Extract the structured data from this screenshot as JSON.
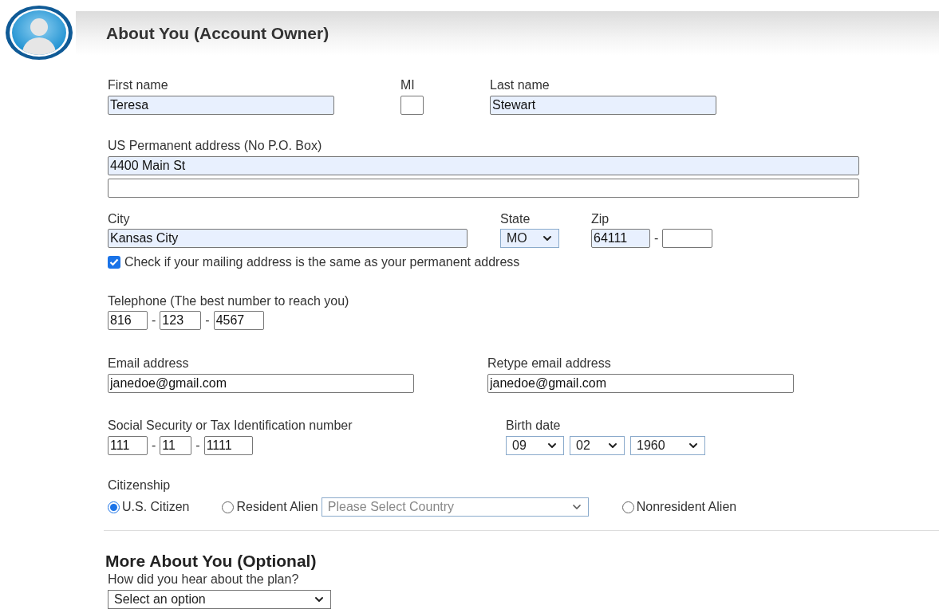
{
  "header": {
    "title": "About You (Account Owner)"
  },
  "first_name": {
    "label": "First name",
    "value": "Teresa",
    "autofilled": true
  },
  "middle_initial": {
    "label": "MI",
    "autofilled": false
  },
  "last_name": {
    "label": "Last name",
    "value": "Stewart",
    "autofilled": true
  },
  "address": {
    "label": "US Permanent address (No P.O. Box)",
    "lines": [
      {
        "value": "4400 Main St",
        "autofilled": true
      },
      {
        "autofilled": false
      }
    ]
  },
  "city": {
    "label": "City",
    "value": "Kansas City",
    "autofilled": true
  },
  "state": {
    "label": "State",
    "value": "MO",
    "autofilled": true
  },
  "zip": {
    "label": "Zip",
    "parts": [
      {
        "value": "64111",
        "autofilled": true
      },
      {
        "prefix": "-",
        "autofilled": false
      }
    ]
  },
  "same_address": {
    "label": "Check if your mailing address is the same as your permanent address",
    "checked": true
  },
  "telephone": {
    "label": "Telephone (The best number to reach you)",
    "parts": [
      {
        "value": "816",
        "autofilled": false
      },
      {
        "prefix": "-",
        "value": "123",
        "autofilled": false
      },
      {
        "prefix": "-",
        "value": "4567",
        "autofilled": false
      }
    ]
  },
  "email": {
    "label": "Email address",
    "value": "janedoe@gmail.com",
    "autofilled": false
  },
  "retype_email": {
    "label": "Retype email address",
    "value": "janedoe@gmail.com",
    "autofilled": false
  },
  "ssn": {
    "label": "Social Security or Tax Identification number",
    "parts": [
      {
        "value": "111",
        "autofilled": false
      },
      {
        "prefix": "-",
        "value": "11",
        "autofilled": false
      },
      {
        "prefix": "-",
        "value": "1111",
        "autofilled": false
      }
    ]
  },
  "birth_date": {
    "label": "Birth date",
    "selects": [
      {
        "value": "09"
      },
      {
        "value": "02"
      },
      {
        "value": "1960"
      }
    ]
  },
  "citizenship": {
    "label": "Citizenship",
    "options": [
      {
        "label": "U.S. Citizen",
        "selected": true
      },
      {
        "label": "Resident Alien",
        "selected": false,
        "country_select": {
          "placeholder": "Please Select Country"
        }
      },
      {
        "label": "Nonresident Alien",
        "selected": false
      }
    ]
  },
  "more": {
    "title": "More About You (Optional)",
    "question": "How did you hear about the plan?",
    "select": {
      "value": "Select an option"
    }
  }
}
